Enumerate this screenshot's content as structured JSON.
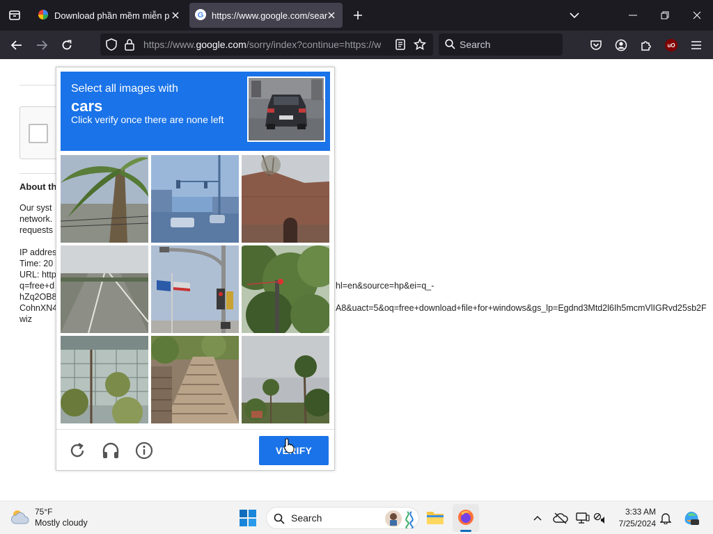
{
  "browser": {
    "tabs": [
      {
        "title": "Download phần mềm miễn phí",
        "active": false
      },
      {
        "title": "https://www.google.com/sear",
        "active": true
      }
    ],
    "url_prefix": "https://www.",
    "url_host": "google.com",
    "url_rest": "/sorry/index?continue=https://w",
    "search_placeholder": "Search",
    "ublock_label": "uO"
  },
  "page": {
    "about_heading": "About th",
    "lines": [
      "Our syst",
      "network.",
      "requests",
      "IP addres",
      "Time: 20",
      "URL: http",
      "q=free+d",
      "hZq2OB8",
      "CohnXN4",
      "wiz"
    ],
    "url_fragment_1": "hl=en&source=hp&ei=q_-",
    "url_fragment_2": "A8&uact=5&oq=free+download+file+for+windows&gs_lp=Egdnd3Mtd2l6Ih5mcmVlIGRvd25sb2F"
  },
  "captcha": {
    "instruction_line1": "Select all images with",
    "target": "cars",
    "instruction_line3": "Click verify once there are none left",
    "verify_label": "VERIFY",
    "tiles": [
      "palm-tree",
      "street-intersection",
      "brick-wall",
      "road",
      "traffic-light-flags",
      "trees-traffic-light",
      "fence-garden",
      "stairs",
      "palm-trees-sky"
    ],
    "colors": {
      "header": "#1a73e8",
      "button": "#1a73e8"
    }
  },
  "taskbar": {
    "temperature": "75°F",
    "weather": "Mostly cloudy",
    "search_label": "Search",
    "time": "3:33 AM",
    "date": "7/25/2024"
  }
}
